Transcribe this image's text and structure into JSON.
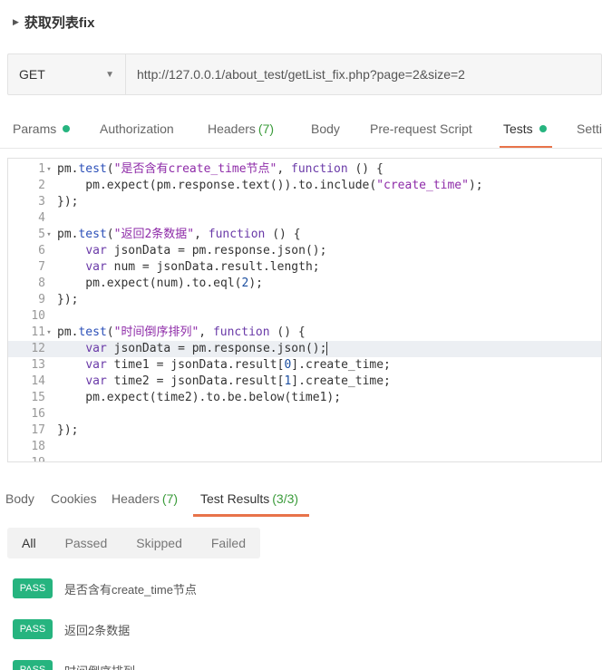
{
  "request": {
    "name": "获取列表fix"
  },
  "url_bar": {
    "method": "GET",
    "url": "http://127.0.0.1/about_test/getList_fix.php?page=2&size=2"
  },
  "request_tabs": [
    {
      "label": "Params",
      "count": "",
      "dot": true,
      "active": false
    },
    {
      "label": "Authorization",
      "count": "",
      "dot": false,
      "active": false
    },
    {
      "label": "Headers",
      "count": "(7)",
      "dot": false,
      "active": false
    },
    {
      "label": "Body",
      "count": "",
      "dot": false,
      "active": false
    },
    {
      "label": "Pre-request Script",
      "count": "",
      "dot": false,
      "active": false
    },
    {
      "label": "Tests",
      "count": "",
      "dot": true,
      "active": true
    },
    {
      "label": "Setti",
      "count": "",
      "dot": false,
      "active": false
    }
  ],
  "editor": {
    "highlight_line": 12,
    "lines": [
      {
        "n": "1",
        "fold": true,
        "tokens": [
          [
            "",
            "pm."
          ],
          [
            "fn",
            "test"
          ],
          [
            "",
            "("
          ],
          [
            "str",
            "\"是否含有create_time节点\""
          ],
          [
            "",
            ", "
          ],
          [
            "kw",
            "function"
          ],
          [
            "",
            " () {"
          ]
        ]
      },
      {
        "n": "2",
        "fold": false,
        "tokens": [
          [
            "",
            "    pm.expect(pm.response.text()).to.include("
          ],
          [
            "str",
            "\"create_time\""
          ],
          [
            "",
            ");"
          ]
        ]
      },
      {
        "n": "3",
        "fold": false,
        "tokens": [
          [
            "",
            "});"
          ]
        ]
      },
      {
        "n": "4",
        "fold": false,
        "tokens": []
      },
      {
        "n": "5",
        "fold": true,
        "tokens": [
          [
            "",
            "pm."
          ],
          [
            "fn",
            "test"
          ],
          [
            "",
            "("
          ],
          [
            "str",
            "\"返回2条数据\""
          ],
          [
            "",
            ", "
          ],
          [
            "kw",
            "function"
          ],
          [
            "",
            " () {"
          ]
        ]
      },
      {
        "n": "6",
        "fold": false,
        "tokens": [
          [
            "",
            "    "
          ],
          [
            "kw",
            "var"
          ],
          [
            "",
            " jsonData = pm.response.json();"
          ]
        ]
      },
      {
        "n": "7",
        "fold": false,
        "tokens": [
          [
            "",
            "    "
          ],
          [
            "kw",
            "var"
          ],
          [
            "",
            " num = jsonData.result.length;"
          ]
        ]
      },
      {
        "n": "8",
        "fold": false,
        "tokens": [
          [
            "",
            "    pm.expect(num).to.eql("
          ],
          [
            "num",
            "2"
          ],
          [
            "",
            ");"
          ]
        ]
      },
      {
        "n": "9",
        "fold": false,
        "tokens": [
          [
            "",
            "});"
          ]
        ]
      },
      {
        "n": "10",
        "fold": false,
        "tokens": []
      },
      {
        "n": "11",
        "fold": true,
        "tokens": [
          [
            "",
            "pm."
          ],
          [
            "fn",
            "test"
          ],
          [
            "",
            "("
          ],
          [
            "str",
            "\"时间倒序排列\""
          ],
          [
            "",
            ", "
          ],
          [
            "kw",
            "function"
          ],
          [
            "",
            " () {"
          ]
        ]
      },
      {
        "n": "12",
        "fold": false,
        "tokens": [
          [
            "",
            "    "
          ],
          [
            "kw",
            "var"
          ],
          [
            "",
            " jsonData = pm.response.json();"
          ]
        ]
      },
      {
        "n": "13",
        "fold": false,
        "tokens": [
          [
            "",
            "    "
          ],
          [
            "kw",
            "var"
          ],
          [
            "",
            " time1 = jsonData.result["
          ],
          [
            "num",
            "0"
          ],
          [
            "",
            "].create_time;"
          ]
        ]
      },
      {
        "n": "14",
        "fold": false,
        "tokens": [
          [
            "",
            "    "
          ],
          [
            "kw",
            "var"
          ],
          [
            "",
            " time2 = jsonData.result["
          ],
          [
            "num",
            "1"
          ],
          [
            "",
            "].create_time;"
          ]
        ]
      },
      {
        "n": "15",
        "fold": false,
        "tokens": [
          [
            "",
            "    pm.expect(time2).to.be.below(time1);"
          ]
        ]
      },
      {
        "n": "16",
        "fold": false,
        "tokens": []
      },
      {
        "n": "17",
        "fold": false,
        "tokens": [
          [
            "",
            "});"
          ]
        ]
      },
      {
        "n": "18",
        "fold": false,
        "tokens": []
      },
      {
        "n": "19",
        "fold": false,
        "tokens": []
      }
    ]
  },
  "response_tabs": [
    {
      "label": "Body",
      "count": "",
      "active": false
    },
    {
      "label": "Cookies",
      "count": "",
      "active": false
    },
    {
      "label": "Headers",
      "count": "(7)",
      "active": false
    },
    {
      "label": "Test Results",
      "count": "(3/3)",
      "active": true
    }
  ],
  "filters": [
    {
      "label": "All",
      "active": true
    },
    {
      "label": "Passed",
      "active": false
    },
    {
      "label": "Skipped",
      "active": false
    },
    {
      "label": "Failed",
      "active": false
    }
  ],
  "results": [
    {
      "status": "PASS",
      "name": "是否含有create_time节点"
    },
    {
      "status": "PASS",
      "name": "返回2条数据"
    },
    {
      "status": "PASS",
      "name": "时间倒序排列"
    }
  ],
  "colors": {
    "accent": "#e8734a",
    "pass": "#26b47f",
    "count": "#3a9b3a"
  }
}
